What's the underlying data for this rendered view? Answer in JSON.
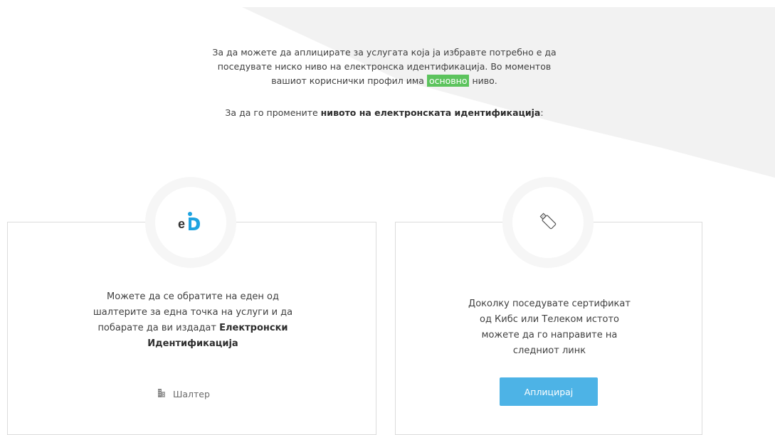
{
  "intro": {
    "line1": "За да можете да аплицирате за услугата која ја избравте потребно е да",
    "line2": "поседувате ниско ниво на електронска идентификација. Во моментов",
    "line3_pre": "вашиот кориснички профил има",
    "level_badge": "основно",
    "line3_post": "ниво.",
    "change_pre": "За да го промените",
    "change_bold": "нивото на електронската идентификација",
    "change_post": ":"
  },
  "card_left": {
    "icon": "eid-logo-icon",
    "text_line1": "Можете да се обратите на еден од",
    "text_line2": "шалтерите за една точка на услуги и да",
    "text_line3_pre": "побарате да ви издадат",
    "text_bold_1": "Електронски",
    "text_bold_2": "Идентификација",
    "link_icon": "building-icon",
    "link_label": "Шалтер"
  },
  "card_right": {
    "icon": "usb-token-icon",
    "text_line1": "Доколку поседувате сертификат",
    "text_line2": "од Кибс или Телеком истото",
    "text_line3": "можете да го направите на",
    "text_line4": "следниот линк",
    "button_label": "Аплицирај"
  },
  "colors": {
    "badge_green": "#5cc35d",
    "button_blue": "#4db3e6",
    "eid_blue": "#1fa3e0",
    "background_shape": "#f2f2f2"
  }
}
